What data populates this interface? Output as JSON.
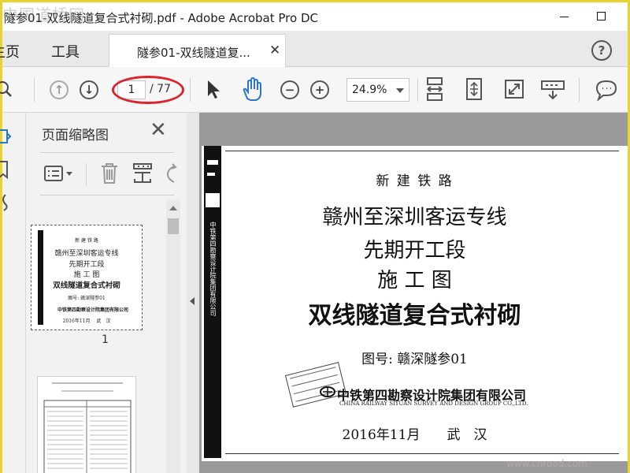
{
  "window": {
    "title": "隧参01-双线隧道复合式衬砌.pdf - Adobe Acrobat Pro DC",
    "watermark": "中国道桥网"
  },
  "tabs": {
    "home": "主页",
    "tools": "工具",
    "document": "隧参01-双线隧道复...",
    "help": "?"
  },
  "toolbar": {
    "current_page": "1",
    "total_pages": "/ 77",
    "zoom": "24.9%"
  },
  "side_panel": {
    "title": "页面缩略图",
    "thumb1_page_number": "1",
    "thumb1": {
      "line1": "新 建 铁 路",
      "line2": "赣州至深圳客运专线",
      "line3": "先期开工段",
      "line4": "施 工 图",
      "line5": "双线隧道复合式衬砌",
      "line6": "图号: 赣深隧参01",
      "line7": "中铁第四勘察设计院集团有限公司",
      "line8": "2016年11月　 武　汉"
    }
  },
  "document": {
    "header": "新 建 铁 路",
    "project": "赣州至深圳客运专线",
    "section": "先期开工段",
    "stage": "施 工 图",
    "drawing_title": "双线隧道复合式衬砌",
    "drawing_number": "图号: 赣深隧参01",
    "company_cn": "中铁第四勘察设计院集团有限公司",
    "company_en": "CHINA RAILWAY SIYUAN SURVEY AND DESIGN GROUP CO.,LTD.",
    "date_place": "2016年11月　　武　汉",
    "side_strip_text": "中铁第四勘察设计院集团有限公司"
  },
  "footer_watermark": "www.cnroad.com",
  "colors": {
    "accent_blue": "#2a78c6",
    "annotation_red": "#d8262c",
    "frame_yellow": "#e7d431"
  }
}
